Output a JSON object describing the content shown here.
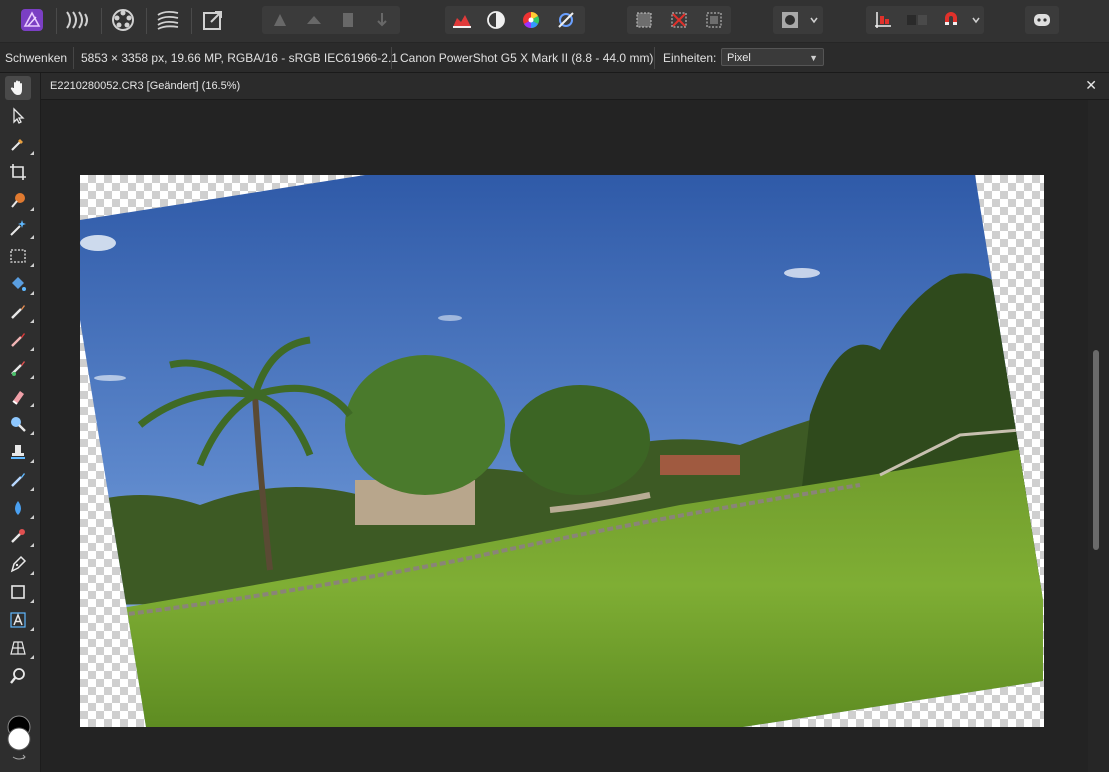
{
  "toolbar": {
    "personas": [
      {
        "name": "photo-persona",
        "icon": "affinity-photo-icon"
      },
      {
        "name": "liquify-persona",
        "icon": "liquify-icon"
      },
      {
        "name": "develop-persona",
        "icon": "develop-icon"
      },
      {
        "name": "tone-mapping-persona",
        "icon": "tone-map-icon"
      },
      {
        "name": "export-persona",
        "icon": "export-icon"
      }
    ],
    "colors": {
      "accent_purple": "#9b4fd6",
      "red": "#e0312b",
      "panel": "#323232"
    }
  },
  "context": {
    "tool_name": "Schwenken",
    "doc_info": "5853 × 3358 px, 19.66 MP, RGBA/16 - sRGB IEC61966-2.1",
    "camera": "Canon PowerShot G5 X Mark II (8.8 - 44.0 mm)",
    "units_label": "Einheiten:",
    "units_value": "Pixel"
  },
  "document": {
    "title": "E2210280052.CR3 [Geändert] (16.5%)",
    "close_glyph": "✕"
  },
  "tools": [
    "hand-tool-icon",
    "move-tool-icon",
    "color-picker-tool-icon",
    "crop-tool-icon",
    "selection-brush-tool-icon",
    "flood-select-tool-icon",
    "rectangular-marquee-tool-icon",
    "flood-fill-tool-icon",
    "paint-brush-tool-icon",
    "color-replacement-brush-icon",
    "pixel-tool-icon",
    "erase-brush-tool-icon",
    "dodge-brush-tool-icon",
    "clone-brush-tool-icon",
    "healing-brush-tool-icon",
    "blur-brush-tool-icon",
    "red-eye-tool-icon",
    "pen-tool-icon",
    "rectangle-tool-icon",
    "artistic-text-tool-icon",
    "mesh-warp-tool-icon",
    "zoom-tool-icon"
  ]
}
